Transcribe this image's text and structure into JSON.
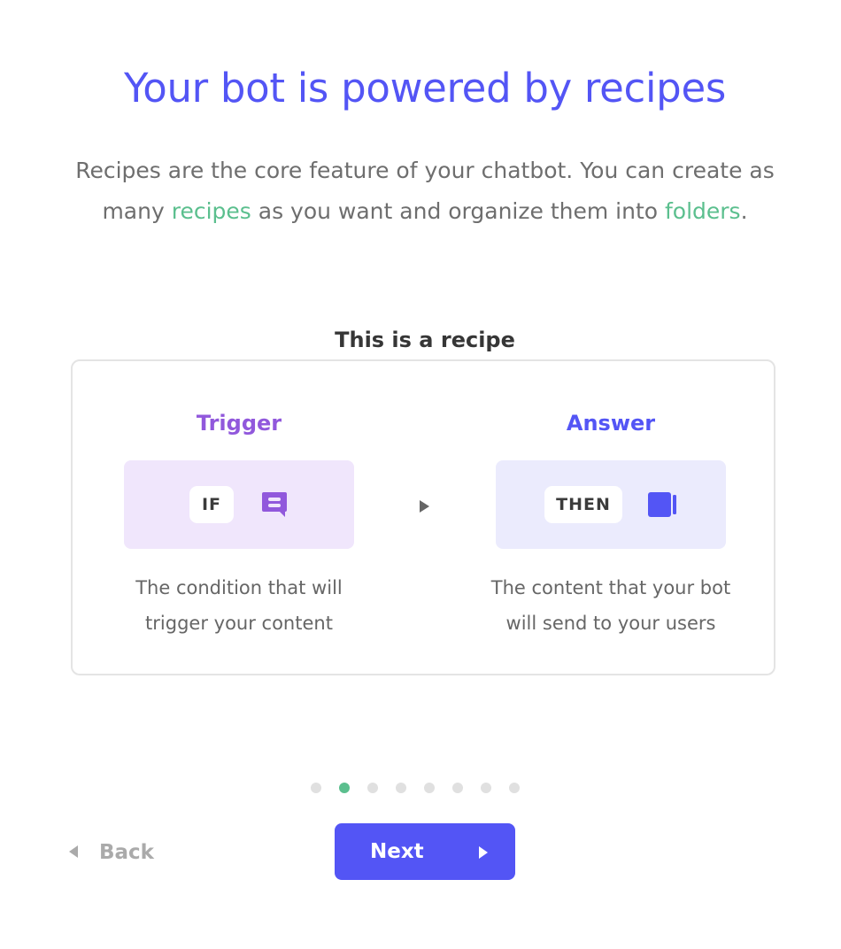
{
  "header": {
    "title": "Your bot is powered by recipes",
    "intro_part1": "Recipes are the core feature of your chatbot. You can create as many ",
    "intro_link1": "recipes",
    "intro_part2": " as you want and organize them into ",
    "intro_link2": "folders",
    "intro_part3": "."
  },
  "recipe": {
    "heading": "This is a recipe",
    "trigger": {
      "title": "Trigger",
      "pill": "IF",
      "icon": "chat-bubble-icon",
      "description": "The condition that will trigger your content"
    },
    "connector_icon": "play-arrow-icon",
    "answer": {
      "title": "Answer",
      "pill": "THEN",
      "icon": "card-stack-icon",
      "description": "The content that your bot will send to your users"
    }
  },
  "pagination": {
    "total_steps": 8,
    "current_step": 2
  },
  "navigation": {
    "back_label": "Back",
    "next_label": "Next"
  },
  "colors": {
    "primary": "#5355f5",
    "trigger": "#9158dc",
    "link": "#5bbf8e",
    "text": "#6e6e6e"
  }
}
